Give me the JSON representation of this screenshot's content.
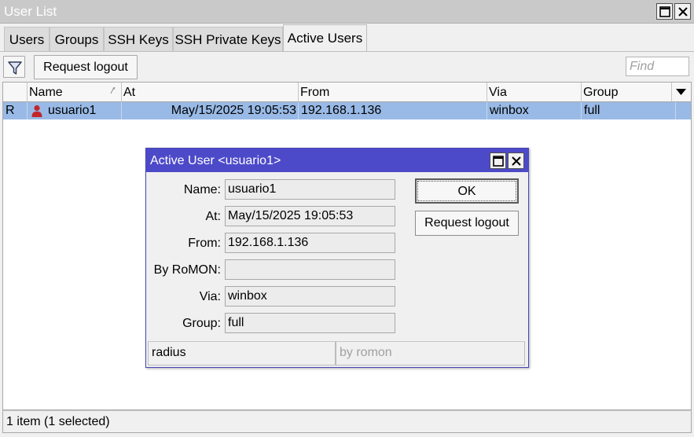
{
  "window": {
    "title": "User List"
  },
  "tabs": [
    {
      "label": "Users",
      "active": false
    },
    {
      "label": "Groups",
      "active": false
    },
    {
      "label": "SSH Keys",
      "active": false
    },
    {
      "label": "SSH Private Keys",
      "active": false
    },
    {
      "label": "Active Users",
      "active": true
    }
  ],
  "toolbar": {
    "filter_icon": "filter-icon",
    "request_logout_label": "Request logout",
    "find_placeholder": "Find"
  },
  "table": {
    "columns": [
      "Name",
      "At",
      "From",
      "Via",
      "Group"
    ],
    "sort_column": "Name",
    "rows": [
      {
        "flag": "R",
        "icon": "user-icon",
        "name": "usuario1",
        "at": "May/15/2025 19:05:53",
        "from": "192.168.1.136",
        "via": "winbox",
        "group": "full",
        "selected": true
      }
    ]
  },
  "status": "1 item (1 selected)",
  "dialog": {
    "title": "Active User <usuario1>",
    "fields": [
      {
        "label": "Name:",
        "value": "usuario1"
      },
      {
        "label": "At:",
        "value": "May/15/2025 19:05:53"
      },
      {
        "label": "From:",
        "value": "192.168.1.136"
      },
      {
        "label": "By RoMON:",
        "value": ""
      },
      {
        "label": "Via:",
        "value": "winbox"
      },
      {
        "label": "Group:",
        "value": "full"
      }
    ],
    "ok_label": "OK",
    "request_logout_label": "Request logout",
    "status_left": "radius",
    "status_right": "by romon"
  },
  "colors": {
    "selection": "#99bae6",
    "dialog_titlebar": "#4d4ac9",
    "user_icon": "#c1272d"
  }
}
